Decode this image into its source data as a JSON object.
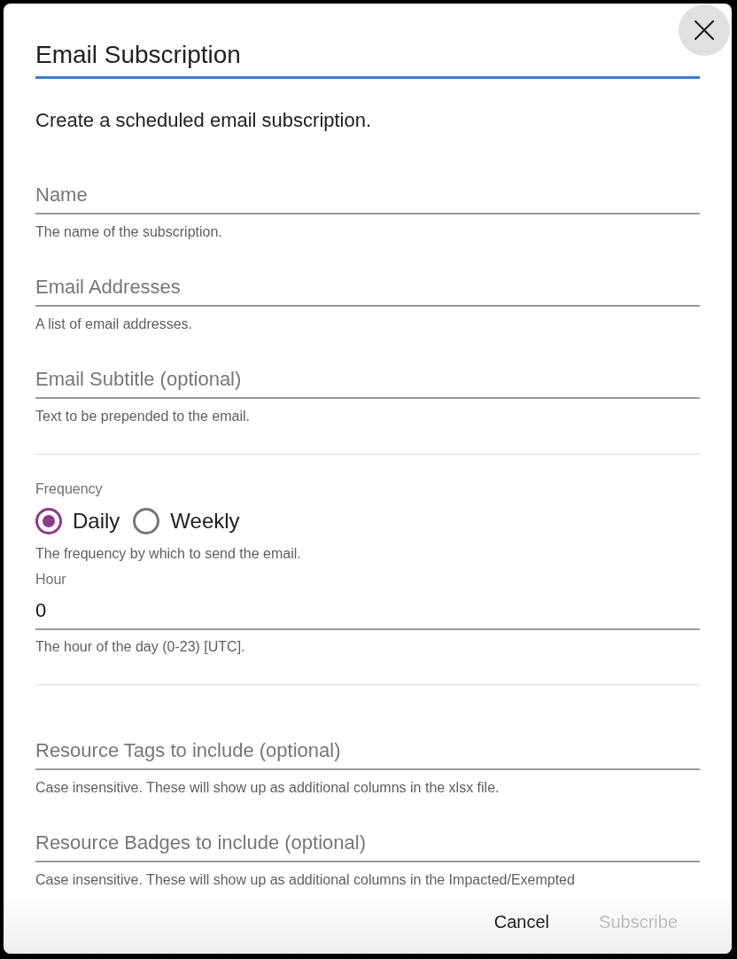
{
  "dialog": {
    "title": "Email Subscription",
    "description": "Create a scheduled email subscription."
  },
  "form": [
    {
      "kind": "text",
      "placeholder": "Name",
      "helper": "The name of the subscription."
    },
    {
      "kind": "text",
      "placeholder": "Email Addresses",
      "helper": "A list of email addresses."
    },
    {
      "kind": "text",
      "placeholder": "Email Subtitle (optional)",
      "helper": "Text to be prepended to the email."
    },
    {
      "kind": "divider"
    },
    {
      "kind": "radio",
      "label": "Frequency",
      "options": [
        {
          "label": "Daily",
          "selected": true
        },
        {
          "label": "Weekly",
          "selected": false
        }
      ],
      "helper": "The frequency by which to send the email."
    },
    {
      "kind": "input",
      "label": "Hour",
      "value": "0",
      "helper": "The hour of the day (0-23) [UTC]."
    },
    {
      "kind": "divider"
    },
    {
      "kind": "text",
      "placeholder": "Resource Tags to include (optional)",
      "helper": "Case insensitive. These will show up as additional columns in the xlsx file."
    },
    {
      "kind": "text",
      "placeholder": "Resource Badges to include (optional)",
      "helper": "Case insensitive. These will show up as additional columns in the Impacted/Exempted"
    }
  ],
  "footer": {
    "buttons": [
      {
        "label": "Cancel",
        "disabled": false
      },
      {
        "label": "Subscribe",
        "disabled": true
      }
    ]
  }
}
